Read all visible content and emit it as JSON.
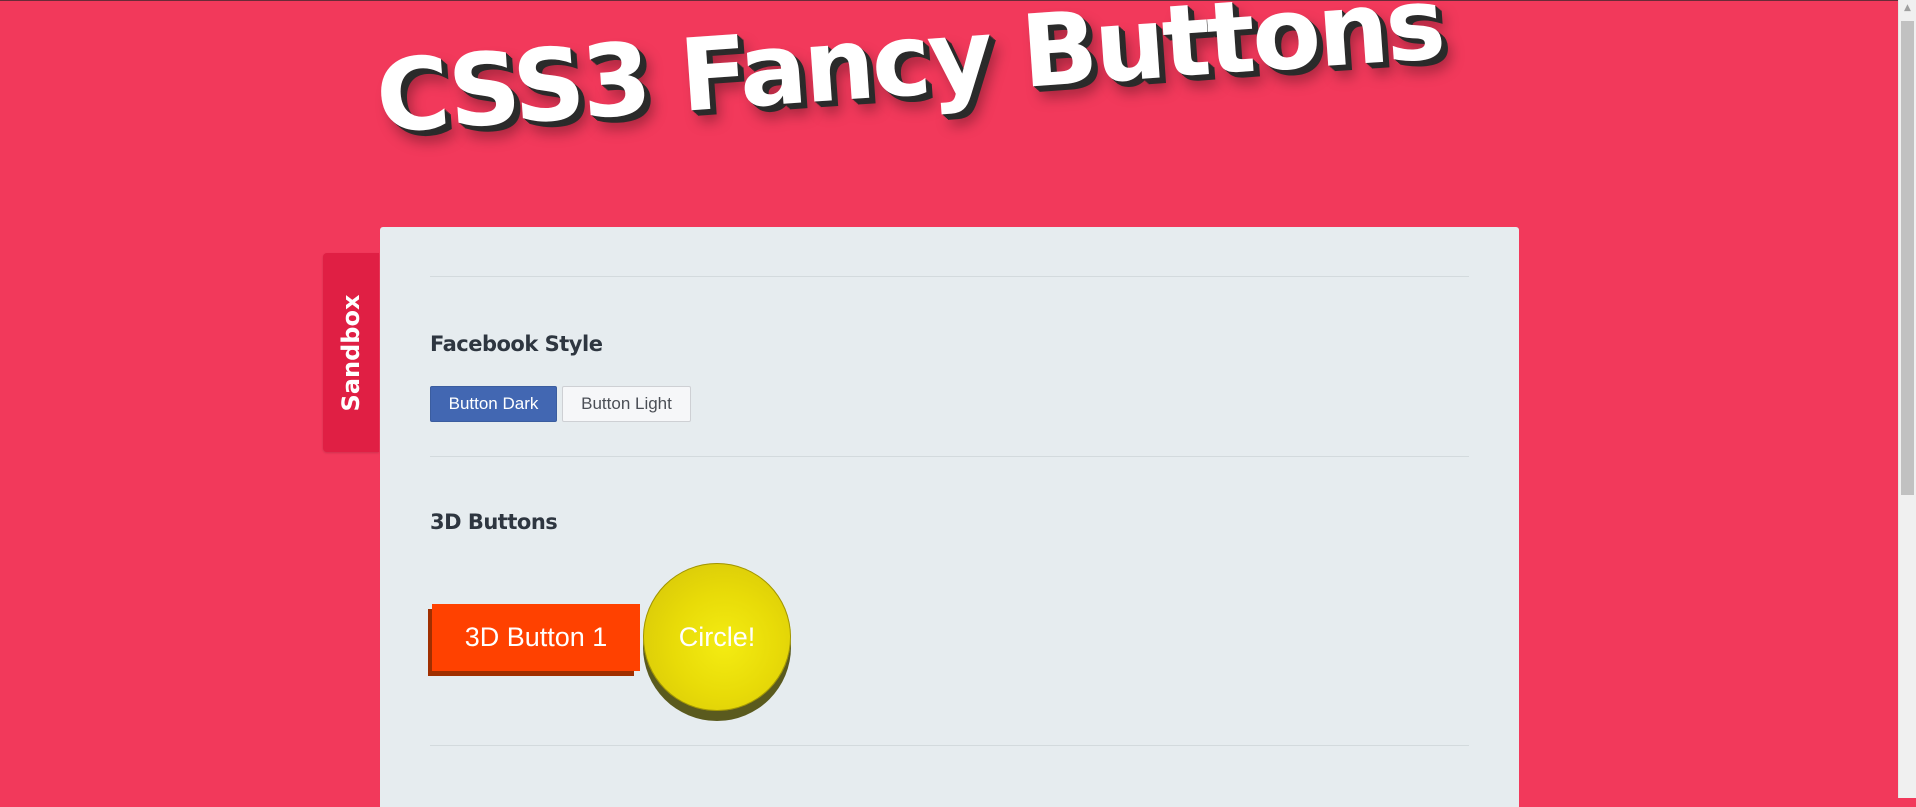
{
  "header": {
    "title": "CSS3 Fancy Buttons"
  },
  "sidebar": {
    "tab_label": "Sandbox"
  },
  "sections": {
    "facebook": {
      "heading": "Facebook Style",
      "dark_button": "Button Dark",
      "light_button": "Button Light"
    },
    "three_d": {
      "heading": "3D Buttons",
      "button_1": "3D Button 1",
      "circle_button": "Circle!"
    }
  },
  "colors": {
    "background": "#f2395b",
    "sandbox_tab": "#e01f44",
    "panel": "#e6ecef",
    "facebook_dark": "#4267b2",
    "facebook_light": "#f6f7f9",
    "button_3d": "#ff4100",
    "circle": "#e8db08"
  },
  "icons": {
    "scroll_up": "scroll-up-arrow-icon"
  }
}
